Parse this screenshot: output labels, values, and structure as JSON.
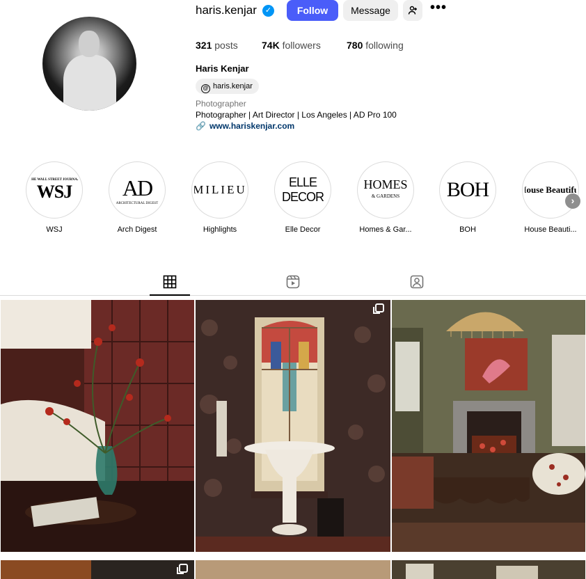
{
  "profile": {
    "username": "haris.kenjar",
    "follow_label": "Follow",
    "message_label": "Message",
    "posts_count": "321",
    "posts_label": "posts",
    "followers_count": "74K",
    "followers_label": "followers",
    "following_count": "780",
    "following_label": "following",
    "full_name": "Haris Kenjar",
    "threads_handle": "haris.kenjar",
    "category": "Photographer",
    "bio": "Photographer | Art Director | Los Angeles | AD Pro 100",
    "website": "www.hariskenjar.com"
  },
  "highlights": [
    {
      "label": "WSJ",
      "logo": "WSJ",
      "logo_sub": "THE WALL STREET JOURNAL"
    },
    {
      "label": "Arch Digest",
      "logo": "AD",
      "logo_sub": "ARCHITECTURAL DIGEST"
    },
    {
      "label": "Highlights",
      "logo": "MILIEU"
    },
    {
      "label": "Elle Decor",
      "logo": "ELLE DECOR"
    },
    {
      "label": "Homes & Gar...",
      "logo": "HOMES",
      "logo_sub": "& GARDENS"
    },
    {
      "label": "BOH",
      "logo": "BOH"
    },
    {
      "label": "House Beauti...",
      "logo": "House Beautiful"
    }
  ],
  "tabs": [
    {
      "name": "posts",
      "icon": "grid-icon",
      "active": true
    },
    {
      "name": "reels",
      "icon": "reels-icon",
      "active": false
    },
    {
      "name": "tagged",
      "icon": "tagged-icon",
      "active": false
    }
  ],
  "colors": {
    "follow_button": "#4a5df9",
    "verified": "#0095f6",
    "link": "#00376b"
  }
}
